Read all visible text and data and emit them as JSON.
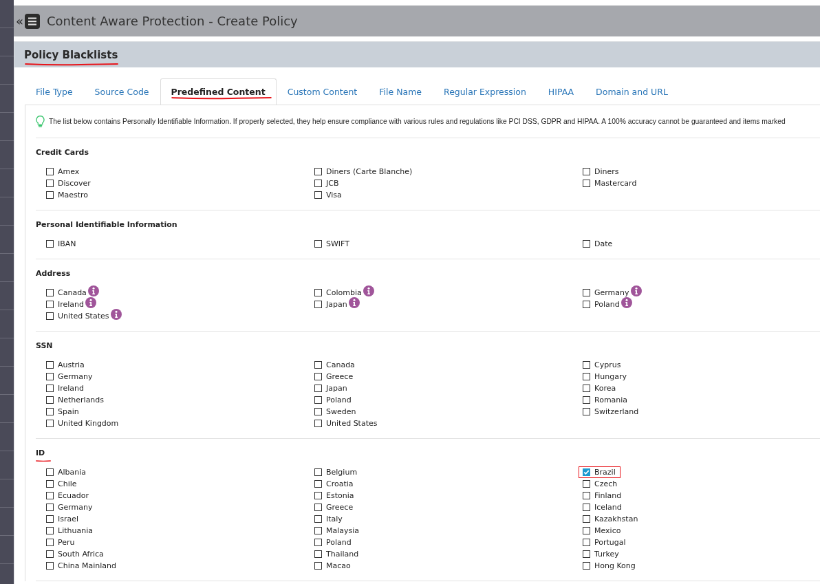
{
  "header": {
    "collapse_glyph": "«",
    "title": "Content Aware Protection - Create Policy"
  },
  "panel": {
    "title": "Policy Blacklists",
    "underlined": true
  },
  "tabs": [
    {
      "label": "File Type",
      "selected": false,
      "underlined": false
    },
    {
      "label": "Source Code",
      "selected": false,
      "underlined": false
    },
    {
      "label": "Predefined Content",
      "selected": true,
      "underlined": true
    },
    {
      "label": "Custom Content",
      "selected": false,
      "underlined": false
    },
    {
      "label": "File Name",
      "selected": false,
      "underlined": false
    },
    {
      "label": "Regular Expression",
      "selected": false,
      "underlined": false
    },
    {
      "label": "HIPAA",
      "selected": false,
      "underlined": false
    },
    {
      "label": "Domain and URL",
      "selected": false,
      "underlined": false
    }
  ],
  "hint": "The list below contains Personally Identifiable Information. If properly selected, they help ensure compliance with various rules and regulations like PCI DSS, GDPR and HIPAA. A 100% accuracy cannot be guaranteed and items marked",
  "sections": [
    {
      "title": "Credit Cards",
      "underlined": false,
      "items": [
        {
          "label": "Amex",
          "checked": false,
          "info": false,
          "marked": false
        },
        {
          "label": "Diners (Carte Blanche)",
          "checked": false,
          "info": false,
          "marked": false
        },
        {
          "label": "Diners",
          "checked": false,
          "info": false,
          "marked": false
        },
        {
          "label": "Discover",
          "checked": false,
          "info": false,
          "marked": false
        },
        {
          "label": "JCB",
          "checked": false,
          "info": false,
          "marked": false
        },
        {
          "label": "Mastercard",
          "checked": false,
          "info": false,
          "marked": false
        },
        {
          "label": "Maestro",
          "checked": false,
          "info": false,
          "marked": false
        },
        {
          "label": "Visa",
          "checked": false,
          "info": false,
          "marked": false
        }
      ]
    },
    {
      "title": "Personal Identifiable Information",
      "underlined": false,
      "items": [
        {
          "label": "IBAN",
          "checked": false,
          "info": false,
          "marked": false
        },
        {
          "label": "SWIFT",
          "checked": false,
          "info": false,
          "marked": false
        },
        {
          "label": "Date",
          "checked": false,
          "info": false,
          "marked": false
        }
      ]
    },
    {
      "title": "Address",
      "underlined": false,
      "items": [
        {
          "label": "Canada",
          "checked": false,
          "info": true,
          "marked": false
        },
        {
          "label": "Colombia",
          "checked": false,
          "info": true,
          "marked": false
        },
        {
          "label": "Germany",
          "checked": false,
          "info": true,
          "marked": false
        },
        {
          "label": "Ireland",
          "checked": false,
          "info": true,
          "marked": false
        },
        {
          "label": "Japan",
          "checked": false,
          "info": true,
          "marked": false
        },
        {
          "label": "Poland",
          "checked": false,
          "info": true,
          "marked": false
        },
        {
          "label": "United States",
          "checked": false,
          "info": true,
          "marked": false
        }
      ]
    },
    {
      "title": "SSN",
      "underlined": false,
      "items": [
        {
          "label": "Austria",
          "checked": false,
          "info": false,
          "marked": false
        },
        {
          "label": "Canada",
          "checked": false,
          "info": false,
          "marked": false
        },
        {
          "label": "Cyprus",
          "checked": false,
          "info": false,
          "marked": false
        },
        {
          "label": "Germany",
          "checked": false,
          "info": false,
          "marked": false
        },
        {
          "label": "Greece",
          "checked": false,
          "info": false,
          "marked": false
        },
        {
          "label": "Hungary",
          "checked": false,
          "info": false,
          "marked": false
        },
        {
          "label": "Ireland",
          "checked": false,
          "info": false,
          "marked": false
        },
        {
          "label": "Japan",
          "checked": false,
          "info": false,
          "marked": false
        },
        {
          "label": "Korea",
          "checked": false,
          "info": false,
          "marked": false
        },
        {
          "label": "Netherlands",
          "checked": false,
          "info": false,
          "marked": false
        },
        {
          "label": "Poland",
          "checked": false,
          "info": false,
          "marked": false
        },
        {
          "label": "Romania",
          "checked": false,
          "info": false,
          "marked": false
        },
        {
          "label": "Spain",
          "checked": false,
          "info": false,
          "marked": false
        },
        {
          "label": "Sweden",
          "checked": false,
          "info": false,
          "marked": false
        },
        {
          "label": "Switzerland",
          "checked": false,
          "info": false,
          "marked": false
        },
        {
          "label": "United Kingdom",
          "checked": false,
          "info": false,
          "marked": false
        },
        {
          "label": "United States",
          "checked": false,
          "info": false,
          "marked": false
        }
      ]
    },
    {
      "title": "ID",
      "underlined": true,
      "items": [
        {
          "label": "Albania",
          "checked": false,
          "info": false,
          "marked": false
        },
        {
          "label": "Belgium",
          "checked": false,
          "info": false,
          "marked": false
        },
        {
          "label": "Brazil",
          "checked": true,
          "info": false,
          "marked": true
        },
        {
          "label": "Chile",
          "checked": false,
          "info": false,
          "marked": false
        },
        {
          "label": "Croatia",
          "checked": false,
          "info": false,
          "marked": false
        },
        {
          "label": "Czech",
          "checked": false,
          "info": false,
          "marked": false
        },
        {
          "label": "Ecuador",
          "checked": false,
          "info": false,
          "marked": false
        },
        {
          "label": "Estonia",
          "checked": false,
          "info": false,
          "marked": false
        },
        {
          "label": "Finland",
          "checked": false,
          "info": false,
          "marked": false
        },
        {
          "label": "Germany",
          "checked": false,
          "info": false,
          "marked": false
        },
        {
          "label": "Greece",
          "checked": false,
          "info": false,
          "marked": false
        },
        {
          "label": "Iceland",
          "checked": false,
          "info": false,
          "marked": false
        },
        {
          "label": "Israel",
          "checked": false,
          "info": false,
          "marked": false
        },
        {
          "label": "Italy",
          "checked": false,
          "info": false,
          "marked": false
        },
        {
          "label": "Kazakhstan",
          "checked": false,
          "info": false,
          "marked": false
        },
        {
          "label": "Lithuania",
          "checked": false,
          "info": false,
          "marked": false
        },
        {
          "label": "Malaysia",
          "checked": false,
          "info": false,
          "marked": false
        },
        {
          "label": "Mexico",
          "checked": false,
          "info": false,
          "marked": false
        },
        {
          "label": "Peru",
          "checked": false,
          "info": false,
          "marked": false
        },
        {
          "label": "Poland",
          "checked": false,
          "info": false,
          "marked": false
        },
        {
          "label": "Portugal",
          "checked": false,
          "info": false,
          "marked": false
        },
        {
          "label": "South Africa",
          "checked": false,
          "info": false,
          "marked": false
        },
        {
          "label": "Thailand",
          "checked": false,
          "info": false,
          "marked": false
        },
        {
          "label": "Turkey",
          "checked": false,
          "info": false,
          "marked": false
        },
        {
          "label": "China Mainland",
          "checked": false,
          "info": false,
          "marked": false
        },
        {
          "label": "Macao",
          "checked": false,
          "info": false,
          "marked": false
        },
        {
          "label": "Hong Kong",
          "checked": false,
          "info": false,
          "marked": false
        }
      ]
    }
  ]
}
